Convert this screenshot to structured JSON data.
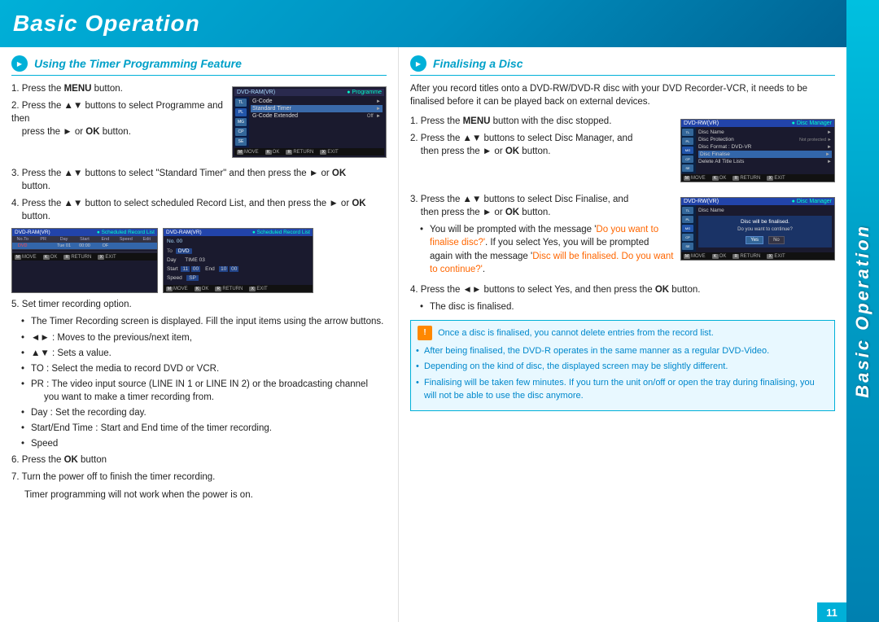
{
  "header": {
    "title": "Basic Operation",
    "sidebar_text": "Basic Operation",
    "page_number": "11"
  },
  "left_section": {
    "title": "Using the Timer Programming Feature",
    "steps": [
      {
        "num": "1",
        "text": "Press the ",
        "bold": "MENU",
        "text2": " button."
      },
      {
        "num": "2",
        "text": "Press the ▲▼ buttons to select Programme and then press the ► or ",
        "bold": "OK",
        "text2": " button."
      },
      {
        "num": "3",
        "text": "Press the ▲▼ buttons to select \"Standard Timer\" and then press the ► or ",
        "bold": "OK",
        "text2": " button."
      },
      {
        "num": "4",
        "text": "Press the ▲▼ button to select scheduled Record List, and then press the ► or ",
        "bold": "OK",
        "text2": " button."
      }
    ],
    "step5": "5. Set timer recording option.",
    "step5_bullets": [
      "The Timer Recording screen is displayed. Fill the input items using the arrow buttons.",
      "◄► : Moves to the previous/next item,",
      "▲▼ : Sets a value.",
      "TO : Select the media to record DVD or VCR.",
      "PR : The video input source (LINE IN 1 or LINE IN 2) or the broadcasting channel you want to make a timer recording from.",
      "Day : Set the recording day.",
      "Start/End Time : Start and End time of the timer recording.",
      "Speed"
    ],
    "step6": {
      "num": "6",
      "text": "Press the ",
      "bold": "OK",
      "text2": " button"
    },
    "step7": "7. Turn the power off to finish the timer recording.",
    "step7_sub": "Timer programming will not work when the power is on.",
    "screen1": {
      "label": "DVD-RAM(VR)",
      "badge": "● Programme",
      "rows": [
        {
          "icon": "TL",
          "label": "G-Code",
          "arrow": "►"
        },
        {
          "icon": "PL",
          "label": "Standard Timer",
          "arrow": "►",
          "selected": true
        },
        {
          "icon": "MG",
          "label": "G-Code Extended",
          "value": "Off",
          "arrow": "►"
        },
        {
          "icon": "CP",
          "label": ""
        },
        {
          "icon": "SE",
          "label": ""
        }
      ],
      "footer": [
        "MOVE",
        "OK",
        "RETURN",
        "EXIT"
      ]
    },
    "screen2": {
      "label": "DVD-RAM(VR)",
      "badge": "● Scheduled Record List",
      "cols": [
        "No.To",
        "PR",
        "Day",
        "Start",
        "End",
        "Speed",
        "Edit"
      ],
      "rows": [
        {
          "no": "DVD",
          "pr": "",
          "day": "Tue 01",
          "start": "00:00",
          "end": "OF",
          "speed": "",
          "edit": "",
          "sel": true
        },
        {
          "no": "",
          "pr": "",
          "day": "",
          "start": "",
          "end": "",
          "speed": "",
          "edit": ""
        }
      ],
      "footer": [
        "MOVE",
        "OK",
        "RETURN",
        "EXIT"
      ]
    },
    "screen3": {
      "label": "DVD-RAM(VR)",
      "badge": "● Scheduled Record List",
      "rows_detail": {
        "no": "No. 00",
        "to": "DVD",
        "day_label": "Day",
        "day_val": "TIME 03",
        "start_label": "Start",
        "start_day": "11 00",
        "start_end": "End",
        "end_val": "10 00",
        "speed_label": "Speed",
        "speed_val": "SP"
      },
      "footer": [
        "MOVE",
        "OK",
        "RETURN",
        "EXIT"
      ]
    }
  },
  "right_section": {
    "title": "Finalising a Disc",
    "intro": "After you record titles onto a DVD-RW/DVD-R disc with your DVD Recorder-VCR, it needs to be finalised before it can be played back on external devices.",
    "step1": {
      "text": "Press the ",
      "bold": "MENU",
      "text2": " button with the disc stopped."
    },
    "step2": {
      "text": "Press the ▲▼ buttons to select Disc Manager, and then press the ► or ",
      "bold": "OK",
      "text2": " button."
    },
    "step3_text": "Press the ▲▼ buttons to select Disc Finalise, and then press the ► or ",
    "step3_bold": "OK",
    "step3_text2": " button.",
    "step3_note": "You will be prompted with the message '",
    "step3_orange1": "Do you want to finalise disc?'",
    "step3_note2": ". If you select Yes, you will be prompted again with the message '",
    "step3_orange2": "Disc will be finalised. Do you want to continue?'",
    "step3_note3": ".",
    "step4": {
      "text": "Press the ◄► buttons to select Yes, and then press the ",
      "bold": "OK",
      "text2": " button."
    },
    "step4_sub": "The disc is finalised.",
    "note_main": "Once a disc is finalised, you cannot delete entries from the  record list.",
    "note_bullets": [
      "After being finalised, the DVD-R operates in the same manner as a regular DVD-Video.",
      "Depending on the kind of disc, the displayed screen may be slightly different.",
      "Finalising will be taken few minutes. If you turn the unit on/off or open the tray during finalising, you will not be able to use the disc anymore."
    ],
    "disc_screen1": {
      "label": "DVD-RW(VR)",
      "badge": "● Disc Manager",
      "rows": [
        {
          "label": "Disc Name",
          "arrow": "►"
        },
        {
          "label": "Disc Protection",
          "value": "Not protected",
          "arrow": "►"
        },
        {
          "label": "Disc Format : DVD-VR",
          "arrow": "►"
        },
        {
          "label": "Disc Finalise",
          "arrow": "►",
          "selected": true
        },
        {
          "label": "Delete All Title Lists",
          "arrow": "►"
        }
      ],
      "footer": [
        "MOVE",
        "OK",
        "RETURN",
        "EXIT"
      ]
    },
    "disc_screen2": {
      "label": "DVD-RW(VR)",
      "badge": "● Disc Manager",
      "dialog": "Disc will be finalised.",
      "dialog2": "Do you want to continue?",
      "yes": "Yes",
      "no": "No",
      "footer": [
        "MOVE",
        "OK",
        "RETURN",
        "EXIT"
      ]
    }
  }
}
